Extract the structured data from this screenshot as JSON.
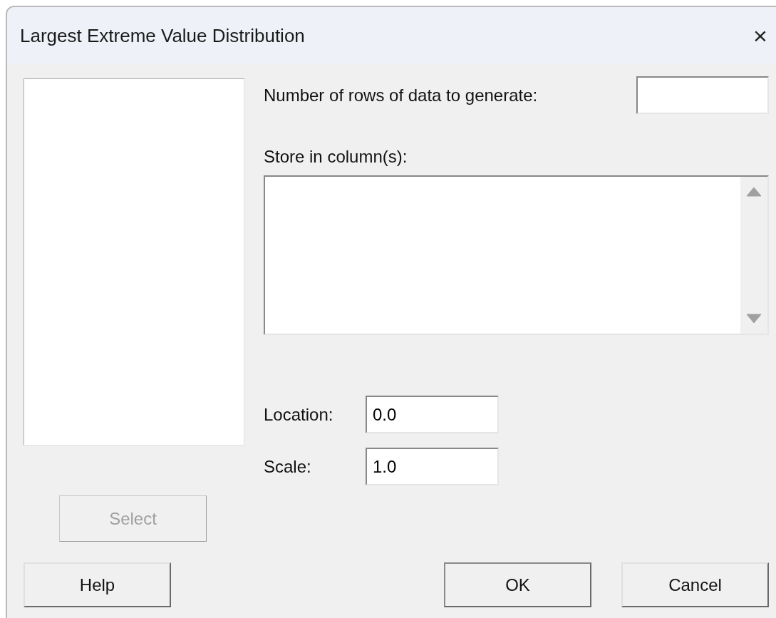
{
  "window": {
    "title": "Largest Extreme Value Distribution",
    "close": "×"
  },
  "variable_list": {
    "select_button": {
      "label": "Select",
      "disabled": true
    }
  },
  "rows_field": {
    "label": "Number of rows of data to generate:"
  },
  "store_field": {
    "label": "Store in column(s):"
  },
  "parameters": [
    {
      "label": "Location:",
      "value": "0.0"
    },
    {
      "label": "Scale:",
      "value": "1.0"
    }
  ],
  "buttons": [
    {
      "kind": "help",
      "label": "Help"
    },
    {
      "kind": "ok",
      "label": "OK"
    },
    {
      "kind": "cancel",
      "label": "Cancel"
    }
  ]
}
